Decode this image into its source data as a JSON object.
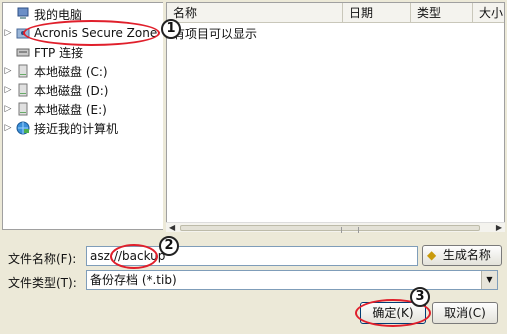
{
  "tree": {
    "items": [
      {
        "label": "我的电脑",
        "icon": "my-computer-icon",
        "expander": ""
      },
      {
        "label": "Acronis Secure Zone",
        "icon": "secure-zone-icon",
        "expander": "▷"
      },
      {
        "label": "FTP 连接",
        "icon": "ftp-icon",
        "expander": ""
      },
      {
        "label": "本地磁盘 (C:)",
        "icon": "disk-icon",
        "expander": "▷"
      },
      {
        "label": "本地磁盘 (D:)",
        "icon": "disk-icon",
        "expander": "▷"
      },
      {
        "label": "本地磁盘 (E:)",
        "icon": "disk-icon",
        "expander": "▷"
      },
      {
        "label": "接近我的计算机",
        "icon": "network-globe-icon",
        "expander": "▷"
      }
    ]
  },
  "list": {
    "columns": [
      "名称",
      "日期",
      "类型",
      "大小"
    ],
    "empty_message": "有项目可以显示"
  },
  "form": {
    "filename_label": "文件名称(F):",
    "filename_value": "asz://backup",
    "generate_name_button": "生成名称",
    "filetype_label": "文件类型(T):",
    "filetype_value": "备份存档 (*.tib)"
  },
  "buttons": {
    "ok": "确定(K)",
    "cancel": "取消(C)"
  },
  "annotations": {
    "steps": [
      "1",
      "2",
      "3"
    ],
    "color": "#e01f2b"
  }
}
